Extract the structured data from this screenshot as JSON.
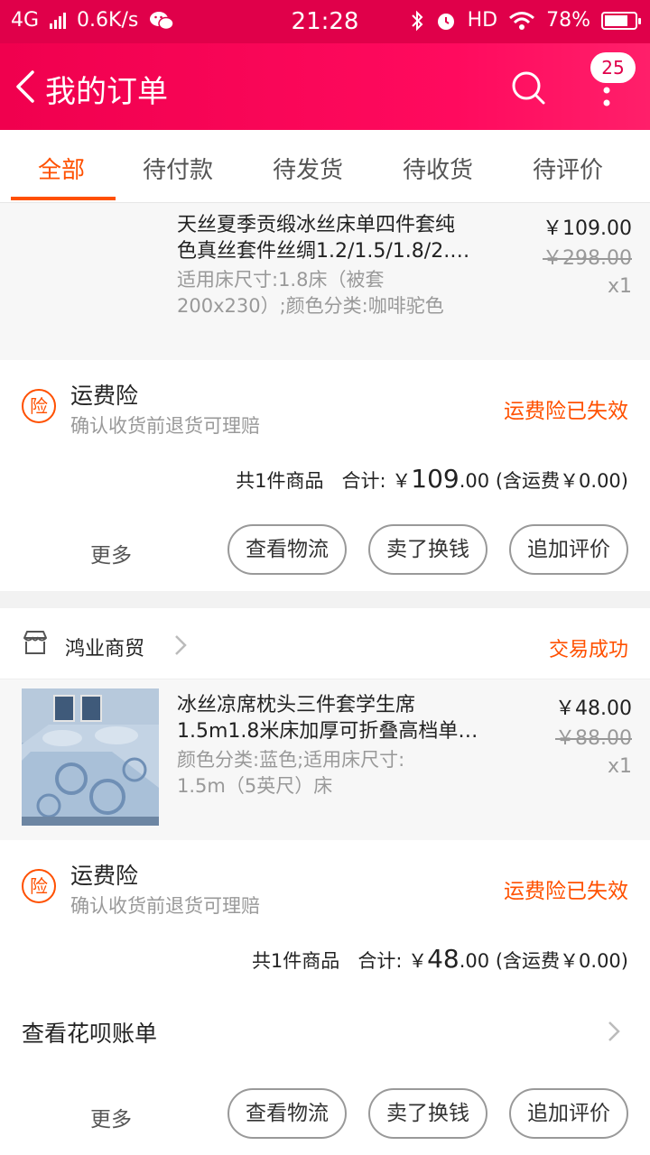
{
  "status_bar": {
    "network": "4G",
    "speed": "0.6K/s",
    "time": "21:28",
    "hd": "HD",
    "battery": "78%",
    "battery_level": 0.78
  },
  "header": {
    "title": "我的订单",
    "badge_count": "25"
  },
  "tabs": [
    "全部",
    "待付款",
    "待发货",
    "待收货",
    "待评价"
  ],
  "active_tab": 0,
  "orders": [
    {
      "item": {
        "title_line1": "天丝夏季贡缎冰丝床单四件套纯",
        "title_line2": "色真丝套件丝绸1.2/1.5/1.8/2.…",
        "sku_line1": "适用床尺寸:1.8床（被套",
        "sku_line2": "200x230）;颜色分类:咖啡驼色",
        "price": "￥109.00",
        "original_price": "￥298.00",
        "quantity": "x1"
      },
      "insurance": {
        "icon": "险",
        "title": "运费险",
        "subtitle": "确认收货前退货可理赔",
        "status": "运费险已失效"
      },
      "summary": {
        "count": "共1件商品",
        "total_label": "合计:",
        "currency": "￥",
        "total_int": "109",
        "total_dec": ".00",
        "shipping": "(含运费￥0.00)"
      },
      "actions": {
        "more": "更多",
        "logistics": "查看物流",
        "resell": "卖了换钱",
        "review": "追加评价"
      }
    },
    {
      "shop": {
        "name": "鸿业商贸",
        "status": "交易成功"
      },
      "item": {
        "title_line1": "冰丝凉席枕头三件套学生席",
        "title_line2": "1.5m1.8米床加厚可折叠高档单…",
        "sku_line1": "颜色分类:蓝色;适用床尺寸:",
        "sku_line2": "1.5m（5英尺）床",
        "price": "￥48.00",
        "original_price": "￥88.00",
        "quantity": "x1"
      },
      "insurance": {
        "icon": "险",
        "title": "运费险",
        "subtitle": "确认收货前退货可理赔",
        "status": "运费险已失效"
      },
      "summary": {
        "count": "共1件商品",
        "total_label": "合计:",
        "currency": "￥",
        "total_int": "48",
        "total_dec": ".00",
        "shipping": "(含运费￥0.00)"
      },
      "huabei": "查看花呗账单",
      "actions": {
        "more": "更多",
        "logistics": "查看物流",
        "resell": "卖了换钱",
        "review": "追加评价"
      }
    }
  ],
  "colors": {
    "brand": "#ff0a5e",
    "accent": "#ff5000"
  }
}
